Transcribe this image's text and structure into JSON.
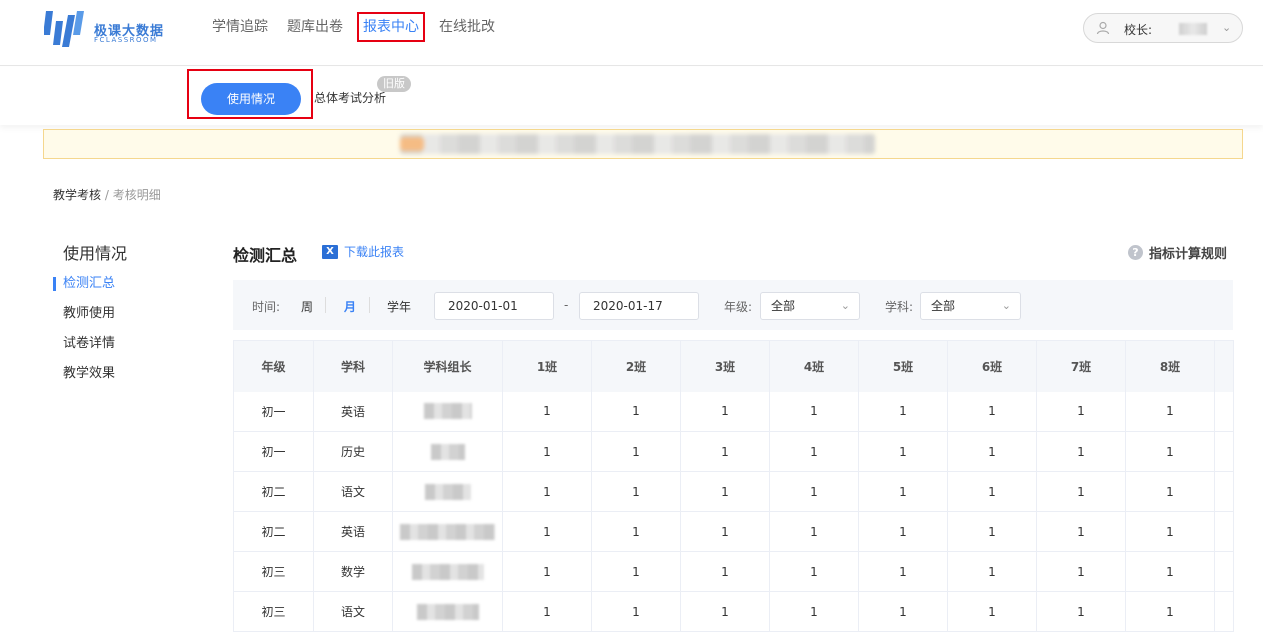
{
  "brand": {
    "name_cn": "极课大数据",
    "name_en": "FCLASSROOM"
  },
  "nav": {
    "items": [
      {
        "label": "学情追踪",
        "active": false
      },
      {
        "label": "题库出卷",
        "active": false
      },
      {
        "label": "报表中心",
        "active": true
      },
      {
        "label": "在线批改",
        "active": false
      }
    ]
  },
  "user": {
    "label": "校长:",
    "icon": "user-icon"
  },
  "subnav": {
    "usage": "使用情况",
    "analysis": "总体考试分析",
    "old_badge": "旧版"
  },
  "breadcrumb": {
    "parent": "教学考核",
    "separator": " / ",
    "current": "考核明细"
  },
  "sidebar": {
    "title": "使用情况",
    "items": [
      {
        "label": "检测汇总",
        "active": true
      },
      {
        "label": "教师使用",
        "active": false
      },
      {
        "label": "试卷详情",
        "active": false
      },
      {
        "label": "教学效果",
        "active": false
      }
    ]
  },
  "main": {
    "title": "检测汇总",
    "download": "下载此报表",
    "rules": "指标计算规则",
    "accent": "#3a82f5",
    "highlight": "#e60012"
  },
  "filters": {
    "time_label": "时间:",
    "week": "周",
    "month": "月",
    "year": "学年",
    "start_date": "2020-01-01",
    "dash": "-",
    "end_date": "2020-01-17",
    "grade_label": "年级:",
    "grade_value": "全部",
    "subject_label": "学科:",
    "subject_value": "全部"
  },
  "table": {
    "columns": [
      "年级",
      "学科",
      "学科组长",
      "1班",
      "2班",
      "3班",
      "4班",
      "5班",
      "6班",
      "7班",
      "8班"
    ],
    "rows": [
      {
        "grade": "初一",
        "subject": "英语",
        "values": [
          "1",
          "1",
          "1",
          "1",
          "1",
          "1",
          "1",
          "1"
        ]
      },
      {
        "grade": "初一",
        "subject": "历史",
        "values": [
          "1",
          "1",
          "1",
          "1",
          "1",
          "1",
          "1",
          "1"
        ]
      },
      {
        "grade": "初二",
        "subject": "语文",
        "values": [
          "1",
          "1",
          "1",
          "1",
          "1",
          "1",
          "1",
          "1"
        ]
      },
      {
        "grade": "初二",
        "subject": "英语",
        "values": [
          "1",
          "1",
          "1",
          "1",
          "1",
          "1",
          "1",
          "1"
        ]
      },
      {
        "grade": "初三",
        "subject": "数学",
        "values": [
          "1",
          "1",
          "1",
          "1",
          "1",
          "1",
          "1",
          "1"
        ]
      },
      {
        "grade": "初三",
        "subject": "语文",
        "values": [
          "1",
          "1",
          "1",
          "1",
          "1",
          "1",
          "1",
          "1"
        ]
      }
    ]
  }
}
